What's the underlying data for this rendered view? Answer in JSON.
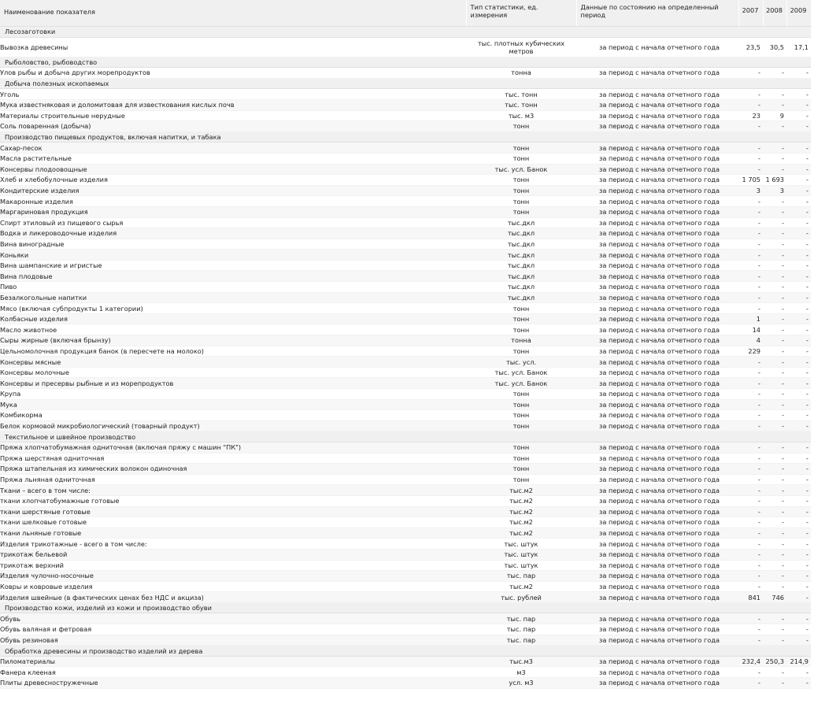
{
  "header": {
    "name": "Наименование показателя",
    "type": "Тип статистики, ед. измерения",
    "period": "Данные по состоянию на определенный период",
    "years": [
      "2007",
      "2008",
      "2009"
    ]
  },
  "rows": [
    {
      "section": "Лесозаготовки"
    },
    {
      "name": "Вывозка древесины",
      "unit": "тыс. плотных кубических метров",
      "period": "за период с начала отчетного года",
      "v": [
        "23,5",
        "30,5",
        "17,1"
      ],
      "two": true
    },
    {
      "section": "Рыболовство, рыбоводство"
    },
    {
      "name": "Улов рыбы и добыча других морепродуктов",
      "unit": "тонна",
      "period": "за период с начала отчетного года",
      "v": [
        "-",
        "-",
        "-"
      ]
    },
    {
      "section": "Добыча полезных ископаемых"
    },
    {
      "name": "Уголь",
      "unit": "тыс. тонн",
      "period": "за период с начала отчетного года",
      "v": [
        "-",
        "-",
        "-"
      ]
    },
    {
      "name": "Мука известняковая и доломитовая для известкования кислых почв",
      "unit": "тыс. тонн",
      "period": "за период с начала отчетного года",
      "v": [
        "-",
        "-",
        "-"
      ]
    },
    {
      "name": "Материалы строительные нерудные",
      "unit": "тыс. м3",
      "period": "за период с начала отчетного года",
      "v": [
        "23",
        "9",
        "-"
      ]
    },
    {
      "name": "Соль поваренная (добыча)",
      "unit": "тонн",
      "period": "за период с начала отчетного года",
      "v": [
        "-",
        "-",
        "-"
      ]
    },
    {
      "section": "Производство пищевых продуктов, включая напитки, и табака"
    },
    {
      "name": "Сахар-песок",
      "unit": "тонн",
      "period": "за период с начала отчетного года",
      "v": [
        "-",
        "-",
        "-"
      ]
    },
    {
      "name": "Масла растительные",
      "unit": "тонн",
      "period": "за период с начала отчетного года",
      "v": [
        "-",
        "-",
        "-"
      ]
    },
    {
      "name": "Консервы плодоовощные",
      "unit": "тыс. усл. Банок",
      "period": "за период с начала отчетного года",
      "v": [
        "-",
        "-",
        "-"
      ]
    },
    {
      "name": "Хлеб и хлебобулочные изделия",
      "unit": "тонн",
      "period": "за период с начала отчетного года",
      "v": [
        "1 705",
        "1 693",
        "-"
      ]
    },
    {
      "name": "Кондитерские изделия",
      "unit": "тонн",
      "period": "за период с начала отчетного года",
      "v": [
        "3",
        "3",
        "-"
      ]
    },
    {
      "name": "Макаронные изделия",
      "unit": "тонн",
      "period": "за период с начала отчетного года",
      "v": [
        "-",
        "-",
        "-"
      ]
    },
    {
      "name": "Маргариновая продукция",
      "unit": "тонн",
      "period": "за период с начала отчетного года",
      "v": [
        "-",
        "-",
        "-"
      ]
    },
    {
      "name": "Спирт этиловый из пищевого сырья",
      "unit": "тыс.дкл",
      "period": "за период с начала отчетного года",
      "v": [
        "-",
        "-",
        "-"
      ]
    },
    {
      "name": "Водка и ликероводочные изделия",
      "unit": "тыс.дкл",
      "period": "за период с начала отчетного года",
      "v": [
        "-",
        "-",
        "-"
      ]
    },
    {
      "name": "Вина виноградные",
      "unit": "тыс.дкл",
      "period": "за период с начала отчетного года",
      "v": [
        "-",
        "-",
        "-"
      ]
    },
    {
      "name": "Коньяки",
      "unit": "тыс.дкл",
      "period": "за период с начала отчетного года",
      "v": [
        "-",
        "-",
        "-"
      ]
    },
    {
      "name": "Вина шампанские и игристые",
      "unit": "тыс.дкл",
      "period": "за период с начала отчетного года",
      "v": [
        "-",
        "-",
        "-"
      ]
    },
    {
      "name": "Вина плодовые",
      "unit": "тыс.дкл",
      "period": "за период с начала отчетного года",
      "v": [
        "-",
        "-",
        "-"
      ]
    },
    {
      "name": "Пиво",
      "unit": "тыс.дкл",
      "period": "за период с начала отчетного года",
      "v": [
        "-",
        "-",
        "-"
      ]
    },
    {
      "name": "Безалкогольные напитки",
      "unit": "тыс.дкл",
      "period": "за период с начала отчетного года",
      "v": [
        "-",
        "-",
        "-"
      ]
    },
    {
      "name": "Мясо (включая субпродукты 1 категории)",
      "unit": "тонн",
      "period": "за период с начала отчетного года",
      "v": [
        "-",
        "-",
        "-"
      ]
    },
    {
      "name": "Колбасные изделия",
      "unit": "тонн",
      "period": "за период с начала отчетного года",
      "v": [
        "1",
        "-",
        "-"
      ]
    },
    {
      "name": "Масло животное",
      "unit": "тонн",
      "period": "за период с начала отчетного года",
      "v": [
        "14",
        "-",
        "-"
      ]
    },
    {
      "name": "Сыры жирные (включая брынзу)",
      "unit": "тонна",
      "period": "за период с начала отчетного года",
      "v": [
        "4",
        "-",
        "-"
      ]
    },
    {
      "name": "Цельномолочная продукция банок (в пересчете на молоко)",
      "unit": "тонн",
      "period": "за период с начала отчетного года",
      "v": [
        "229",
        "-",
        "-"
      ]
    },
    {
      "name": "Консервы мясные",
      "unit": "тыс. усл.",
      "period": "за период с начала отчетного года",
      "v": [
        "-",
        "-",
        "-"
      ]
    },
    {
      "name": "Консервы молочные",
      "unit": "тыс. усл. Банок",
      "period": "за период с начала отчетного года",
      "v": [
        "-",
        "-",
        "-"
      ]
    },
    {
      "name": "Консервы и пресервы рыбные и из морепродуктов",
      "unit": "тыс. усл. Банок",
      "period": "за период с начала отчетного года",
      "v": [
        "-",
        "-",
        "-"
      ]
    },
    {
      "name": "Крупа",
      "unit": "тонн",
      "period": "за период с начала отчетного года",
      "v": [
        "-",
        "-",
        "-"
      ]
    },
    {
      "name": "Мука",
      "unit": "тонн",
      "period": "за период с начала отчетного года",
      "v": [
        "-",
        "-",
        "-"
      ]
    },
    {
      "name": "Комбикорма",
      "unit": "тонн",
      "period": "за период с начала отчетного года",
      "v": [
        "-",
        "-",
        "-"
      ]
    },
    {
      "name": "Белок кормовой микробиологический (товарный продукт)",
      "unit": "тонн",
      "period": "за период с начала отчетного года",
      "v": [
        "-",
        "-",
        "-"
      ]
    },
    {
      "section": "Текстильное и швейное производство"
    },
    {
      "name": "Пряжа хлопчатобумажная одниточная (включая пряжу с машин \"ПК\")",
      "unit": "тонн",
      "period": "за период с начала отчетного года",
      "v": [
        "-",
        "-",
        "-"
      ]
    },
    {
      "name": "Пряжа шерстяная одниточная",
      "unit": "тонн",
      "period": "за период с начала отчетного года",
      "v": [
        "-",
        "-",
        "-"
      ]
    },
    {
      "name": "Пряжа штапельная из химических волокон одиночная",
      "unit": "тонн",
      "period": "за период с начала отчетного года",
      "v": [
        "-",
        "-",
        "-"
      ]
    },
    {
      "name": "Пряжа льняная одниточная",
      "unit": "тонн",
      "period": "за период с начала отчетного года",
      "v": [
        "-",
        "-",
        "-"
      ]
    },
    {
      "name": "Ткани – всего в том числе:",
      "unit": "тыс.м2",
      "period": "за период с начала отчетного года",
      "v": [
        "-",
        "-",
        "-"
      ]
    },
    {
      "name": "ткани хлопчатобумажные готовые",
      "unit": "тыс.м2",
      "period": "за период с начала отчетного года",
      "v": [
        "-",
        "-",
        "-"
      ]
    },
    {
      "name": "ткани шерстяные готовые",
      "unit": "тыс.м2",
      "period": "за период с начала отчетного года",
      "v": [
        "-",
        "-",
        "-"
      ]
    },
    {
      "name": "ткани шелковые готовые",
      "unit": "тыс.м2",
      "period": "за период с начала отчетного года",
      "v": [
        "-",
        "-",
        "-"
      ]
    },
    {
      "name": "ткани льняные готовые",
      "unit": "тыс.м2",
      "period": "за период с начала отчетного года",
      "v": [
        "-",
        "-",
        "-"
      ]
    },
    {
      "name": "Изделия трикотажные - всего в том числе:",
      "unit": "тыс. штук",
      "period": "за период с начала отчетного года",
      "v": [
        "-",
        "-",
        "-"
      ]
    },
    {
      "name": "трикотаж бельевой",
      "unit": "тыс. штук",
      "period": "за период с начала отчетного года",
      "v": [
        "-",
        "-",
        "-"
      ]
    },
    {
      "name": "трикотаж верхний",
      "unit": "тыс. штук",
      "period": "за период с начала отчетного года",
      "v": [
        "-",
        "-",
        "-"
      ]
    },
    {
      "name": "Изделия чулочно-носочные",
      "unit": "тыс. пар",
      "period": "за период с начала отчетного года",
      "v": [
        "-",
        "-",
        "-"
      ]
    },
    {
      "name": "Ковры и ковровые изделия",
      "unit": "тыс.м2",
      "period": "за период с начала отчетного года",
      "v": [
        "-",
        "-",
        "-"
      ]
    },
    {
      "name": "Изделия швейные (в фактических ценах без НДС и акциза)",
      "unit": "тыс. рублей",
      "period": "за период с начала отчетного года",
      "v": [
        "841",
        "746",
        "-"
      ]
    },
    {
      "section": "Производство кожи, изделий из кожи и производство обуви"
    },
    {
      "name": "Обувь",
      "unit": "тыс. пар",
      "period": "за период с начала отчетного года",
      "v": [
        "-",
        "-",
        "-"
      ]
    },
    {
      "name": "Обувь валяная и фетровая",
      "unit": "тыс. пар",
      "period": "за период с начала отчетного года",
      "v": [
        "-",
        "-",
        "-"
      ]
    },
    {
      "name": "Обувь резиновая",
      "unit": "тыс. пар",
      "period": "за период с начала отчетного года",
      "v": [
        "-",
        "-",
        "-"
      ]
    },
    {
      "section": "Обработка древесины и производство изделий из дерева"
    },
    {
      "name": "Пиломатериалы",
      "unit": "тыс.м3",
      "period": "за период с начала отчетного года",
      "v": [
        "232,4",
        "250,3",
        "214,9"
      ]
    },
    {
      "name": "Фанера клееная",
      "unit": "м3",
      "period": "за период с начала отчетного года",
      "v": [
        "-",
        "-",
        "-"
      ]
    },
    {
      "name": "Плиты древесностружечные",
      "unit": "усл. м3",
      "period": "за период с начала отчетного года",
      "v": [
        "-",
        "-",
        "-"
      ]
    }
  ]
}
